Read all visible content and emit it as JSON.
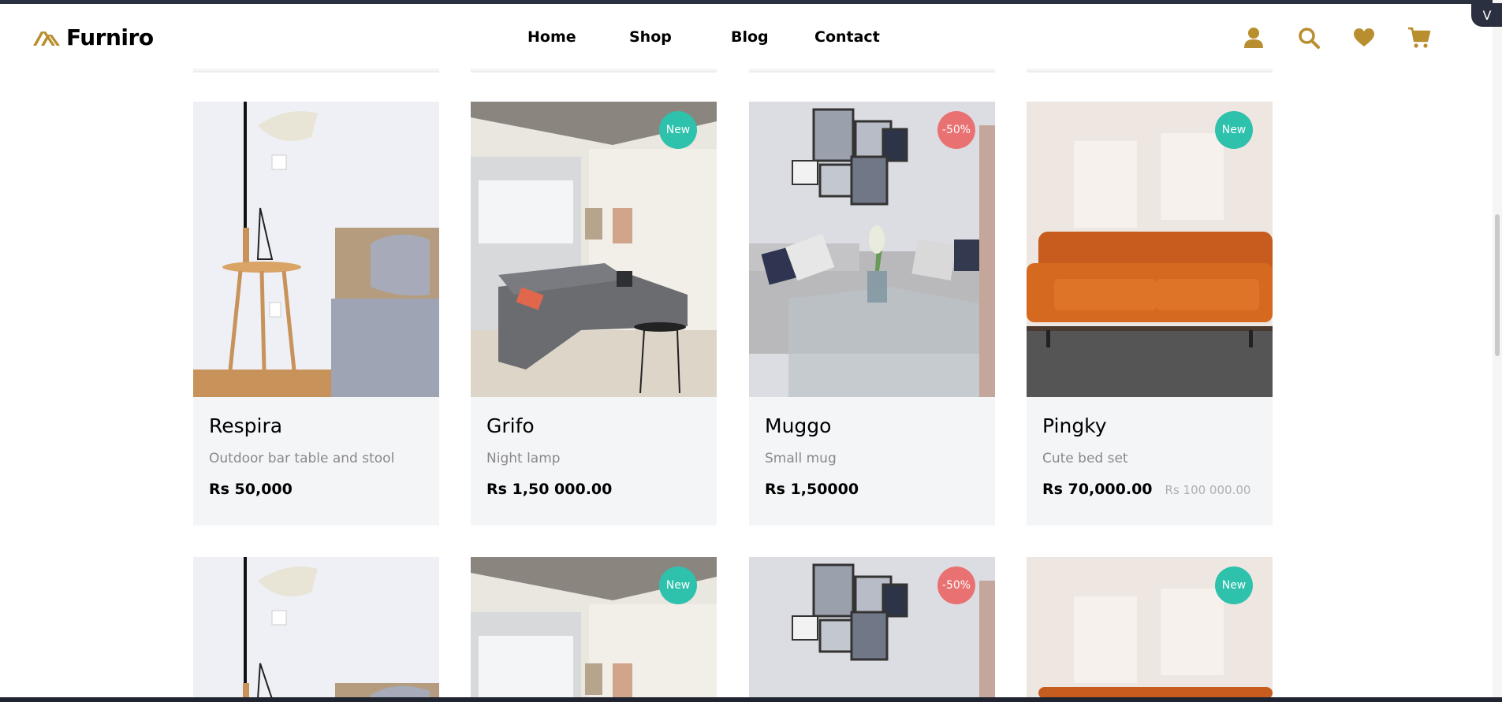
{
  "navbar": {
    "brand": "Furniro",
    "links": [
      "Home",
      "Shop",
      "Blog",
      "Contact"
    ],
    "icons": [
      "user-icon",
      "search-icon",
      "heart-icon",
      "cart-icon"
    ]
  },
  "colors": {
    "accent": "#b88e2f",
    "card_bg": "#f4f5f7",
    "badge_new": "#2ec1ac",
    "badge_sale": "#e97171"
  },
  "products": [
    {
      "title": "Respira",
      "subtitle": "Outdoor bar table and stool",
      "price": "Rs 50,000",
      "old_price": "",
      "badge": ""
    },
    {
      "title": "Grifo",
      "subtitle": "Night lamp",
      "price": "Rs 1,50 000.00",
      "old_price": "",
      "badge": "New"
    },
    {
      "title": "Muggo",
      "subtitle": "Small mug",
      "price": "Rs 1,50000",
      "old_price": "",
      "badge": "-50%"
    },
    {
      "title": "Pingky",
      "subtitle": "Cute bed set",
      "price": "Rs 70,000.00",
      "old_price": "Rs 100 000.00",
      "badge": "New"
    }
  ],
  "next_row_badges": [
    "",
    "New",
    "-50%",
    "New"
  ],
  "extension": {
    "label": "V"
  }
}
